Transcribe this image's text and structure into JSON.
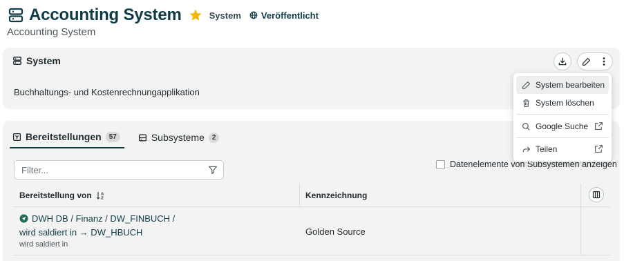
{
  "header": {
    "title": "Accounting System",
    "type_label": "System",
    "status_label": "Veröffentlicht",
    "subtitle": "Accounting System",
    "starred": true
  },
  "info_card": {
    "heading": "System",
    "description": "Buchhaltungs- und Kostenrechnungapplikation"
  },
  "tabs": [
    {
      "label": "Bereitstellungen",
      "count": "57",
      "active": true
    },
    {
      "label": "Subsysteme",
      "count": "2",
      "active": false
    }
  ],
  "filter": {
    "placeholder": "Filter...",
    "value": ""
  },
  "show_sub_elements": {
    "label": "Datenelemente von Subsystemen anzeigen",
    "checked": false
  },
  "table": {
    "columns": [
      "Bereitstellung von",
      "Kennzeichnung"
    ],
    "rows": [
      {
        "path_line1": "DWH DB / Finanz / DW_FINBUCH /",
        "path_line2": "wird saldiert in → DW_HBUCH",
        "subtext": "wird saldiert in",
        "kennzeichnung": "Golden Source"
      }
    ]
  },
  "menu": {
    "edit": "System bearbeiten",
    "delete": "System löschen",
    "google": "Google Suche",
    "share": "Teilen"
  },
  "colors": {
    "brand": "#0e3b45",
    "star": "#f2b705",
    "card_bg": "#f3f3f3"
  },
  "icons": [
    "server-icon",
    "star-icon",
    "globe-icon",
    "download-icon",
    "pencil-icon",
    "more-vertical-icon",
    "filter-icon",
    "sort-icon",
    "columns-icon",
    "trash-icon",
    "search-icon",
    "share-icon",
    "external-link-icon",
    "send-icon"
  ]
}
